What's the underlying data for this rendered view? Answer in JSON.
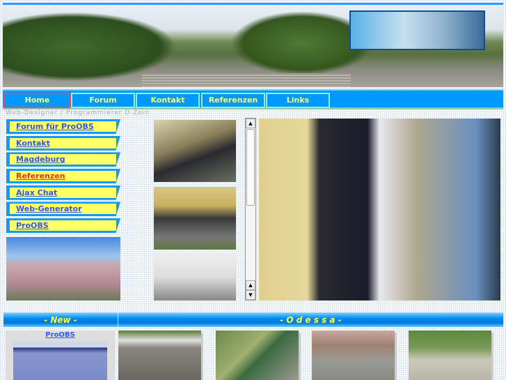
{
  "header": {
    "subtitle": "Web-Designer / Programmierer D.Zoin"
  },
  "nav": [
    {
      "label": "Home",
      "active": true
    },
    {
      "label": "Forum"
    },
    {
      "label": "Kontakt"
    },
    {
      "label": "Referenzen"
    },
    {
      "label": "Links"
    }
  ],
  "menu": [
    {
      "label": "Forum für ProOBS"
    },
    {
      "label": "Kontakt"
    },
    {
      "label": "Magdeburg"
    },
    {
      "label": "Referenzen",
      "current": true
    },
    {
      "label": "Ajax Chat"
    },
    {
      "label": "Web-Generator"
    },
    {
      "label": "ProOBS"
    }
  ],
  "sections": {
    "new": "- New -",
    "odessa": "- O d e s s a -"
  },
  "new_box": {
    "link": "ProOBS"
  },
  "colors": {
    "nav": "#0099ff",
    "nav_text": "#ffff66",
    "menu_bg": "#ffff66",
    "link": "#3355ee",
    "current_link": "#ee3311"
  }
}
